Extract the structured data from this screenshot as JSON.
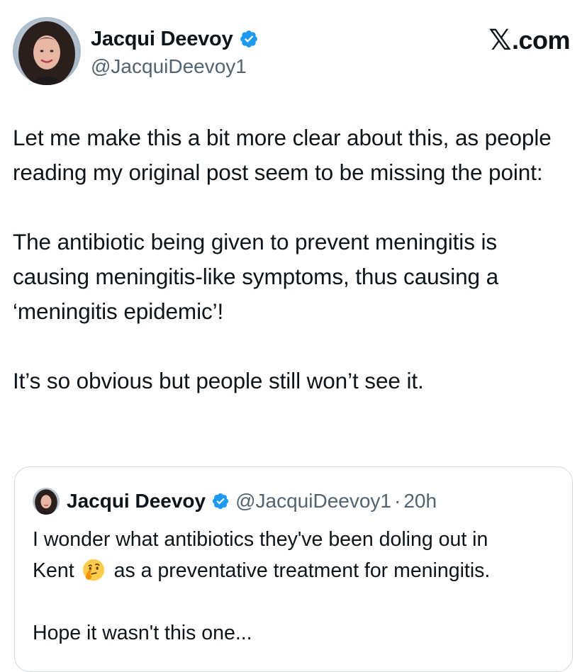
{
  "author": {
    "display_name": "Jacqui Deevoy",
    "handle": "@JacquiDeevoy1",
    "avatar_icon": "profile-photo",
    "verified_icon": "verified-badge-icon"
  },
  "brand": {
    "x_glyph": "𝕏",
    "suffix": ".com"
  },
  "tweet": {
    "paragraphs": [
      "Let me make this a bit more clear about this, as people reading my original post seem to be missing the point:",
      "The antibiotic being given to prevent meningitis is causing meningitis-like symptoms, thus causing a ‘meningitis epidemic’!",
      "It’s so obvious but people still won’t see it."
    ]
  },
  "quoted_tweet": {
    "display_name": "Jacqui Deevoy",
    "handle": "@JacquiDeevoy1",
    "separator": "·",
    "time": "20h",
    "text_line1": "I wonder what antibiotics they've been doling out in",
    "text_line2_before": "Kent",
    "emoji": "thinking-face-emoji",
    "text_line2_after": "as a preventative treatment for meningitis.",
    "text_para2": "Hope it wasn't this one..."
  },
  "colors": {
    "text_primary": "#0f1419",
    "text_secondary": "#536471",
    "verified_blue": "#1d9bf0",
    "border": "#cfd9de"
  }
}
